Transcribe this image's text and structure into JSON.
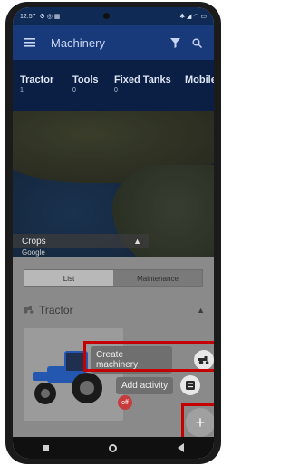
{
  "status": {
    "time": "12:57",
    "left_icons": "⚙ ◎ ▦",
    "right_icons": "✱ ◢ ◠ ▭"
  },
  "appbar": {
    "title": "Machinery",
    "menu_icon": "hamburger-icon",
    "filter_icon": "filter-icon",
    "search_icon": "search-icon"
  },
  "tabs": [
    {
      "label": "Tractor",
      "count": "1"
    },
    {
      "label": "Tools",
      "count": "0"
    },
    {
      "label": "Fixed Tanks",
      "count": "0"
    },
    {
      "label": "Mobile",
      "count": ""
    }
  ],
  "map": {
    "layer_label": "Crops",
    "attribution": "Google"
  },
  "segment": {
    "list": "List",
    "maintenance": "Maintenance"
  },
  "section": {
    "title": "Tractor"
  },
  "machine": {
    "status": "off"
  },
  "fab_menu": {
    "create_machinery": "Create machinery",
    "add_activity": "Add activity",
    "fab_symbol": "+"
  },
  "colors": {
    "appbar": "#183a7a",
    "highlight": "#c40000",
    "off_badge": "#c83b3b"
  }
}
